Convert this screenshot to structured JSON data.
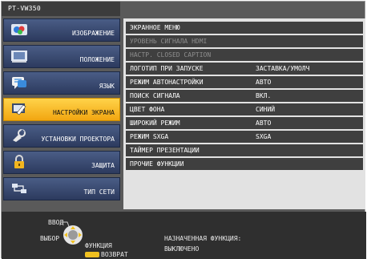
{
  "model": "PT-VW350",
  "sidebar": {
    "items": [
      {
        "label": "ИЗОБРАЖЕНИЕ",
        "icon": "image-icon"
      },
      {
        "label": "ПОЛОЖЕНИЕ",
        "icon": "position-icon"
      },
      {
        "label": "ЯЗЫК",
        "icon": "language-icon"
      },
      {
        "label": "НАСТРОЙКИ ЭКРАНА",
        "icon": "display-settings-icon",
        "active": true
      },
      {
        "label": "УСТАНОВКИ ПРОЕКТОРА",
        "icon": "projector-settings-icon"
      },
      {
        "label": "ЗАЩИТА",
        "icon": "lock-icon"
      },
      {
        "label": "ТИП СЕТИ",
        "icon": "network-icon"
      }
    ]
  },
  "content": {
    "rows": [
      {
        "name": "ЭКРАННОЕ МЕНЮ",
        "value": ""
      },
      {
        "name": "УРОВЕНЬ СИГНАЛА HDMI",
        "value": "",
        "disabled": true
      },
      {
        "name": "НАСТР. CLOSED CAPTION",
        "value": "",
        "disabled": true
      },
      {
        "name": "ЛОГОТИП ПРИ ЗАПУСКЕ",
        "value": "ЗАСТАВКА/УМОЛЧ"
      },
      {
        "name": "РЕЖИМ АВТОНАСТРОЙКИ",
        "value": "АВТО"
      },
      {
        "name": "ПОИСК СИГНАЛА",
        "value": "ВКЛ."
      },
      {
        "name": "ЦВЕТ ФОНА",
        "value": "СИНИЙ"
      },
      {
        "name": "ШИРОКИЙ РЕЖИМ",
        "value": "АВТО"
      },
      {
        "name": "РЕЖИМ SXGA",
        "value": "SXGA"
      },
      {
        "name": "ТАЙМЕР ПРЕЗЕНТАЦИИ",
        "value": ""
      },
      {
        "name": "ПРОЧИЕ ФУНКЦИИ",
        "value": ""
      }
    ]
  },
  "footer": {
    "enter": "ВВОД",
    "select": "ВЫБОР",
    "function": "ФУНКЦИЯ",
    "back": "ВОЗВРАТ",
    "assigned_label": "НАЗНАЧЕННАЯ ФУНКЦИЯ:",
    "assigned_value": "ВЫКЛЮЧЕНО"
  },
  "colors": {
    "active_tab": "#f2a610",
    "inactive_tab": "#2c3a5e",
    "row_bg": "#3f3f3f",
    "panel_bg": "#e2e2e2"
  }
}
